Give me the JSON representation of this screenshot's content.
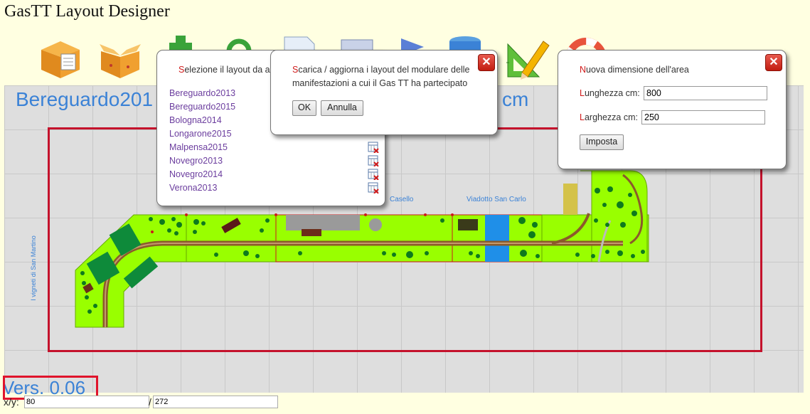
{
  "app": {
    "title": "GasTT Layout Designer"
  },
  "toolbar": {
    "icons": [
      "open-box-icon",
      "open-box-icon",
      "add-green-icon",
      "refresh-green-icon",
      "document-icon",
      "cart-icon",
      "flag-icon",
      "database-icon",
      "design-tools-icon",
      "lifebuoy-icon"
    ]
  },
  "canvas": {
    "layout_title": "Bereguardo201",
    "layout_title_tail": "cm",
    "labels": {
      "vigneti": "I vigneti di San Martino",
      "casello": "Casello",
      "viadotto": "Viadotto San Carlo"
    }
  },
  "layout_dialog": {
    "title_first": "S",
    "title_rest": "elezione il layout da a",
    "layouts": [
      "Bereguardo2013",
      "Bereguardo2015",
      "Bologna2014",
      "Longarone2015",
      "Malpensa2015",
      "Novegro2013",
      "Novegro2014",
      "Verona2013"
    ]
  },
  "download_dialog": {
    "text_first": "S",
    "text_line1": "carica / aggiorna i layout del modulare delle",
    "text_line2": "manifestazioni a cui il Gas TT ha partecipato",
    "ok_label": "OK",
    "cancel_label": "Annulla"
  },
  "area_dialog": {
    "title_first": "N",
    "title_rest": "uova dimensione dell'area",
    "length_first": "L",
    "length_rest": "unghezza cm:",
    "length_value": "800",
    "width_first": "L",
    "width_rest": "arghezza cm:",
    "width_value": "250",
    "set_label": "Imposta"
  },
  "footer": {
    "version": "Vers. 0.06",
    "xy_label": "x/y:",
    "x_value": "80",
    "separator": "/",
    "y_value": "272"
  },
  "colors": {
    "accent_blue": "#3b82d6",
    "area_border": "#c4122c",
    "module_green": "#99ff00",
    "track_brown": "#8b5a2b"
  }
}
